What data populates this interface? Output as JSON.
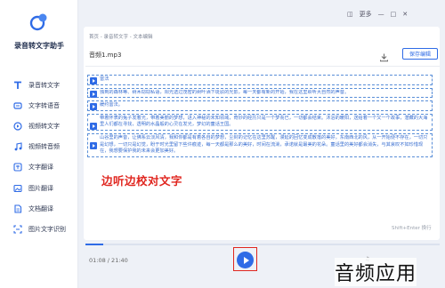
{
  "app": {
    "name": "录音转文字助手",
    "accent": "#2f6be6"
  },
  "sidebar": {
    "items": [
      {
        "label": "录音转文字",
        "icon": "text-t-icon"
      },
      {
        "label": "文字转语音",
        "icon": "speech-icon"
      },
      {
        "label": "视频转文字",
        "icon": "video-icon"
      },
      {
        "label": "视频转音频",
        "icon": "music-icon"
      },
      {
        "label": "文字翻译",
        "icon": "translate-icon"
      },
      {
        "label": "图片翻译",
        "icon": "image-translate-icon"
      },
      {
        "label": "文档翻译",
        "icon": "doc-translate-icon"
      },
      {
        "label": "图片文字识别",
        "icon": "ocr-icon"
      }
    ]
  },
  "topbar": {
    "more_label": "更多"
  },
  "main": {
    "breadcrumb": "首页 - 录音转文字 - 文本编辑",
    "filename": "音频1.mp3",
    "save_label": "保存编辑",
    "segments": [
      "雷法",
      "独到的森林等、树木窃窃私语，阳光透过茂密的树叶洒下斑驳的光影，每一天都有新的开始，我在这里聆听大自然的声音。",
      "缓约雷法。",
      "带着怀表的兔子发着光，带着美丽的梦想，进入神秘的未知领域，奇妙的经历只是一个梦而已，一切都会结束。沐浴的暖阳，送给着一个又一个故事，潜藏的大海里人们都在寻找，透明的水晶般的心灵在发光，梦幻的童话王国。",
      "山谷里的声音，让佛系云淡风清，我和你都是有着各自的梦想，尘封的记忆在这里苏醒，漫延的回忆变成散落的美好，东南西北的风，从一开始便不存在，一切只是幻想，一切只是幻觉，盼于时光里留下些许痕迹，每一天都是那么的美好，时间在流淌，承诺就是最美的花朵。童话里的美好都会消失，与其哀叹不如珍惜现在，我想要保护我的未来会更加美好。"
    ],
    "caption": "边听边校对文字",
    "shortcut_hint": "Shift+Enter 换行"
  },
  "player": {
    "time_display": "01:08 / 21:40",
    "progress": 0.05
  },
  "watermark": "音频应用"
}
